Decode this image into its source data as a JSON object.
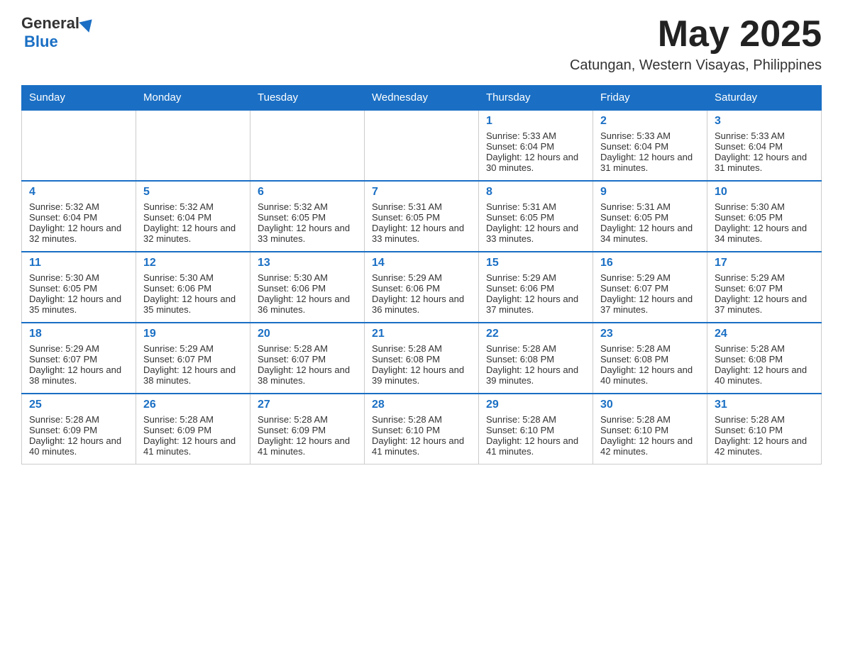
{
  "header": {
    "logo": {
      "general": "General",
      "blue": "Blue"
    },
    "title": "May 2025",
    "location": "Catungan, Western Visayas, Philippines"
  },
  "days_of_week": [
    "Sunday",
    "Monday",
    "Tuesday",
    "Wednesday",
    "Thursday",
    "Friday",
    "Saturday"
  ],
  "weeks": [
    [
      {
        "day": "",
        "sunrise": "",
        "sunset": "",
        "daylight": ""
      },
      {
        "day": "",
        "sunrise": "",
        "sunset": "",
        "daylight": ""
      },
      {
        "day": "",
        "sunrise": "",
        "sunset": "",
        "daylight": ""
      },
      {
        "day": "",
        "sunrise": "",
        "sunset": "",
        "daylight": ""
      },
      {
        "day": "1",
        "sunrise": "Sunrise: 5:33 AM",
        "sunset": "Sunset: 6:04 PM",
        "daylight": "Daylight: 12 hours and 30 minutes."
      },
      {
        "day": "2",
        "sunrise": "Sunrise: 5:33 AM",
        "sunset": "Sunset: 6:04 PM",
        "daylight": "Daylight: 12 hours and 31 minutes."
      },
      {
        "day": "3",
        "sunrise": "Sunrise: 5:33 AM",
        "sunset": "Sunset: 6:04 PM",
        "daylight": "Daylight: 12 hours and 31 minutes."
      }
    ],
    [
      {
        "day": "4",
        "sunrise": "Sunrise: 5:32 AM",
        "sunset": "Sunset: 6:04 PM",
        "daylight": "Daylight: 12 hours and 32 minutes."
      },
      {
        "day": "5",
        "sunrise": "Sunrise: 5:32 AM",
        "sunset": "Sunset: 6:04 PM",
        "daylight": "Daylight: 12 hours and 32 minutes."
      },
      {
        "day": "6",
        "sunrise": "Sunrise: 5:32 AM",
        "sunset": "Sunset: 6:05 PM",
        "daylight": "Daylight: 12 hours and 33 minutes."
      },
      {
        "day": "7",
        "sunrise": "Sunrise: 5:31 AM",
        "sunset": "Sunset: 6:05 PM",
        "daylight": "Daylight: 12 hours and 33 minutes."
      },
      {
        "day": "8",
        "sunrise": "Sunrise: 5:31 AM",
        "sunset": "Sunset: 6:05 PM",
        "daylight": "Daylight: 12 hours and 33 minutes."
      },
      {
        "day": "9",
        "sunrise": "Sunrise: 5:31 AM",
        "sunset": "Sunset: 6:05 PM",
        "daylight": "Daylight: 12 hours and 34 minutes."
      },
      {
        "day": "10",
        "sunrise": "Sunrise: 5:30 AM",
        "sunset": "Sunset: 6:05 PM",
        "daylight": "Daylight: 12 hours and 34 minutes."
      }
    ],
    [
      {
        "day": "11",
        "sunrise": "Sunrise: 5:30 AM",
        "sunset": "Sunset: 6:05 PM",
        "daylight": "Daylight: 12 hours and 35 minutes."
      },
      {
        "day": "12",
        "sunrise": "Sunrise: 5:30 AM",
        "sunset": "Sunset: 6:06 PM",
        "daylight": "Daylight: 12 hours and 35 minutes."
      },
      {
        "day": "13",
        "sunrise": "Sunrise: 5:30 AM",
        "sunset": "Sunset: 6:06 PM",
        "daylight": "Daylight: 12 hours and 36 minutes."
      },
      {
        "day": "14",
        "sunrise": "Sunrise: 5:29 AM",
        "sunset": "Sunset: 6:06 PM",
        "daylight": "Daylight: 12 hours and 36 minutes."
      },
      {
        "day": "15",
        "sunrise": "Sunrise: 5:29 AM",
        "sunset": "Sunset: 6:06 PM",
        "daylight": "Daylight: 12 hours and 37 minutes."
      },
      {
        "day": "16",
        "sunrise": "Sunrise: 5:29 AM",
        "sunset": "Sunset: 6:07 PM",
        "daylight": "Daylight: 12 hours and 37 minutes."
      },
      {
        "day": "17",
        "sunrise": "Sunrise: 5:29 AM",
        "sunset": "Sunset: 6:07 PM",
        "daylight": "Daylight: 12 hours and 37 minutes."
      }
    ],
    [
      {
        "day": "18",
        "sunrise": "Sunrise: 5:29 AM",
        "sunset": "Sunset: 6:07 PM",
        "daylight": "Daylight: 12 hours and 38 minutes."
      },
      {
        "day": "19",
        "sunrise": "Sunrise: 5:29 AM",
        "sunset": "Sunset: 6:07 PM",
        "daylight": "Daylight: 12 hours and 38 minutes."
      },
      {
        "day": "20",
        "sunrise": "Sunrise: 5:28 AM",
        "sunset": "Sunset: 6:07 PM",
        "daylight": "Daylight: 12 hours and 38 minutes."
      },
      {
        "day": "21",
        "sunrise": "Sunrise: 5:28 AM",
        "sunset": "Sunset: 6:08 PM",
        "daylight": "Daylight: 12 hours and 39 minutes."
      },
      {
        "day": "22",
        "sunrise": "Sunrise: 5:28 AM",
        "sunset": "Sunset: 6:08 PM",
        "daylight": "Daylight: 12 hours and 39 minutes."
      },
      {
        "day": "23",
        "sunrise": "Sunrise: 5:28 AM",
        "sunset": "Sunset: 6:08 PM",
        "daylight": "Daylight: 12 hours and 40 minutes."
      },
      {
        "day": "24",
        "sunrise": "Sunrise: 5:28 AM",
        "sunset": "Sunset: 6:08 PM",
        "daylight": "Daylight: 12 hours and 40 minutes."
      }
    ],
    [
      {
        "day": "25",
        "sunrise": "Sunrise: 5:28 AM",
        "sunset": "Sunset: 6:09 PM",
        "daylight": "Daylight: 12 hours and 40 minutes."
      },
      {
        "day": "26",
        "sunrise": "Sunrise: 5:28 AM",
        "sunset": "Sunset: 6:09 PM",
        "daylight": "Daylight: 12 hours and 41 minutes."
      },
      {
        "day": "27",
        "sunrise": "Sunrise: 5:28 AM",
        "sunset": "Sunset: 6:09 PM",
        "daylight": "Daylight: 12 hours and 41 minutes."
      },
      {
        "day": "28",
        "sunrise": "Sunrise: 5:28 AM",
        "sunset": "Sunset: 6:10 PM",
        "daylight": "Daylight: 12 hours and 41 minutes."
      },
      {
        "day": "29",
        "sunrise": "Sunrise: 5:28 AM",
        "sunset": "Sunset: 6:10 PM",
        "daylight": "Daylight: 12 hours and 41 minutes."
      },
      {
        "day": "30",
        "sunrise": "Sunrise: 5:28 AM",
        "sunset": "Sunset: 6:10 PM",
        "daylight": "Daylight: 12 hours and 42 minutes."
      },
      {
        "day": "31",
        "sunrise": "Sunrise: 5:28 AM",
        "sunset": "Sunset: 6:10 PM",
        "daylight": "Daylight: 12 hours and 42 minutes."
      }
    ]
  ]
}
